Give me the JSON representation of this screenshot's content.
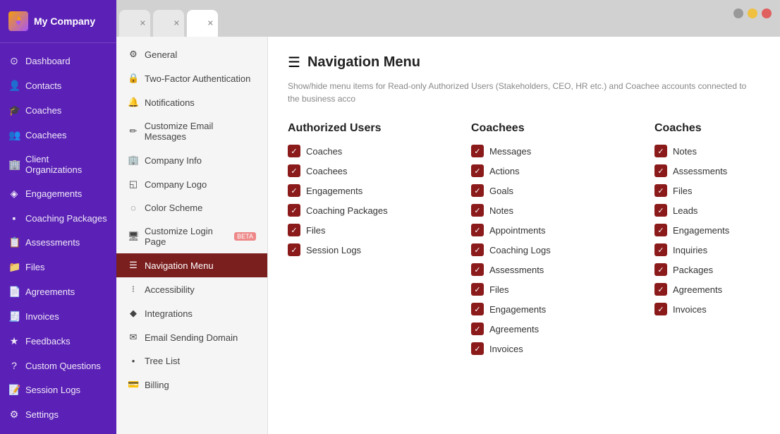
{
  "sidebar": {
    "company": "My Company",
    "items": [
      {
        "label": "Dashboard",
        "icon": "⊙",
        "id": "dashboard"
      },
      {
        "label": "Contacts",
        "icon": "👤",
        "id": "contacts"
      },
      {
        "label": "Coaches",
        "icon": "🎓",
        "id": "coaches"
      },
      {
        "label": "Coachees",
        "icon": "👥",
        "id": "coachees"
      },
      {
        "label": "Client Organizations",
        "icon": "🏢",
        "id": "client-orgs"
      },
      {
        "label": "Engagements",
        "icon": "◈",
        "id": "engagements"
      },
      {
        "label": "Coaching Packages",
        "icon": "▪",
        "id": "coaching-packages"
      },
      {
        "label": "Assessments",
        "icon": "📋",
        "id": "assessments"
      },
      {
        "label": "Files",
        "icon": "📁",
        "id": "files"
      },
      {
        "label": "Agreements",
        "icon": "📄",
        "id": "agreements"
      },
      {
        "label": "Invoices",
        "icon": "🧾",
        "id": "invoices"
      },
      {
        "label": "Feedbacks",
        "icon": "★",
        "id": "feedbacks"
      },
      {
        "label": "Custom Questions",
        "icon": "?",
        "id": "custom-questions"
      },
      {
        "label": "Session Logs",
        "icon": "📝",
        "id": "session-logs"
      },
      {
        "label": "Settings",
        "icon": "⚙",
        "id": "settings"
      }
    ]
  },
  "tabs": [
    {
      "label": "",
      "active": false,
      "id": "tab1"
    },
    {
      "label": "",
      "active": false,
      "id": "tab2"
    },
    {
      "label": "",
      "active": true,
      "id": "tab3"
    }
  ],
  "settings_nav": {
    "items": [
      {
        "label": "General",
        "icon": "⚙",
        "id": "general",
        "active": false
      },
      {
        "label": "Two-Factor Authentication",
        "icon": "🔒",
        "id": "2fa",
        "active": false
      },
      {
        "label": "Notifications",
        "icon": "🔔",
        "id": "notifications",
        "active": false
      },
      {
        "label": "Customize Email Messages",
        "icon": "✏",
        "id": "email-messages",
        "active": false
      },
      {
        "label": "Company Info",
        "icon": "🏢",
        "id": "company-info",
        "active": false
      },
      {
        "label": "Company Logo",
        "icon": "◱",
        "id": "company-logo",
        "active": false
      },
      {
        "label": "Color Scheme",
        "icon": "◌",
        "id": "color-scheme",
        "active": false
      },
      {
        "label": "Customize Login Page",
        "icon": "🖥",
        "id": "customize-login",
        "active": false,
        "beta": true
      },
      {
        "label": "Navigation Menu",
        "icon": "☰",
        "id": "navigation-menu",
        "active": true
      },
      {
        "label": "Accessibility",
        "icon": "⁝",
        "id": "accessibility",
        "active": false
      },
      {
        "label": "Integrations",
        "icon": "◆",
        "id": "integrations",
        "active": false
      },
      {
        "label": "Email Sending Domain",
        "icon": "✉",
        "id": "email-domain",
        "active": false
      },
      {
        "label": "Tree List",
        "icon": "•",
        "id": "tree-list",
        "active": false
      },
      {
        "label": "Billing",
        "icon": "💳",
        "id": "billing",
        "active": false
      }
    ]
  },
  "main": {
    "title": "Navigation Menu",
    "description": "Show/hide menu items for Read-only Authorized Users (Stakeholders, CEO, HR etc.) and Coachee accounts connected to the business acco",
    "authorized_users": {
      "title": "Authorized Users",
      "items": [
        {
          "label": "Coaches",
          "checked": true
        },
        {
          "label": "Coachees",
          "checked": true
        },
        {
          "label": "Engagements",
          "checked": true
        },
        {
          "label": "Coaching Packages",
          "checked": true
        },
        {
          "label": "Files",
          "checked": true
        },
        {
          "label": "Session Logs",
          "checked": true
        }
      ]
    },
    "coachees": {
      "title": "Coachees",
      "items": [
        {
          "label": "Messages",
          "checked": true
        },
        {
          "label": "Actions",
          "checked": true
        },
        {
          "label": "Goals",
          "checked": true
        },
        {
          "label": "Notes",
          "checked": true
        },
        {
          "label": "Appointments",
          "checked": true
        },
        {
          "label": "Coaching Logs",
          "checked": true
        },
        {
          "label": "Assessments",
          "checked": true
        },
        {
          "label": "Files",
          "checked": true
        },
        {
          "label": "Engagements",
          "checked": true
        },
        {
          "label": "Agreements",
          "checked": true
        },
        {
          "label": "Invoices",
          "checked": true
        }
      ]
    },
    "coaches": {
      "title": "Coaches",
      "items": [
        {
          "label": "Notes",
          "checked": true
        },
        {
          "label": "Assessments",
          "checked": true
        },
        {
          "label": "Files",
          "checked": true
        },
        {
          "label": "Leads",
          "checked": true
        },
        {
          "label": "Engagements",
          "checked": true
        },
        {
          "label": "Inquiries",
          "checked": true
        },
        {
          "label": "Packages",
          "checked": true
        },
        {
          "label": "Agreements",
          "checked": true
        },
        {
          "label": "Invoices",
          "checked": true
        }
      ]
    }
  },
  "checkmark": "✓",
  "menu_icon": "☰"
}
